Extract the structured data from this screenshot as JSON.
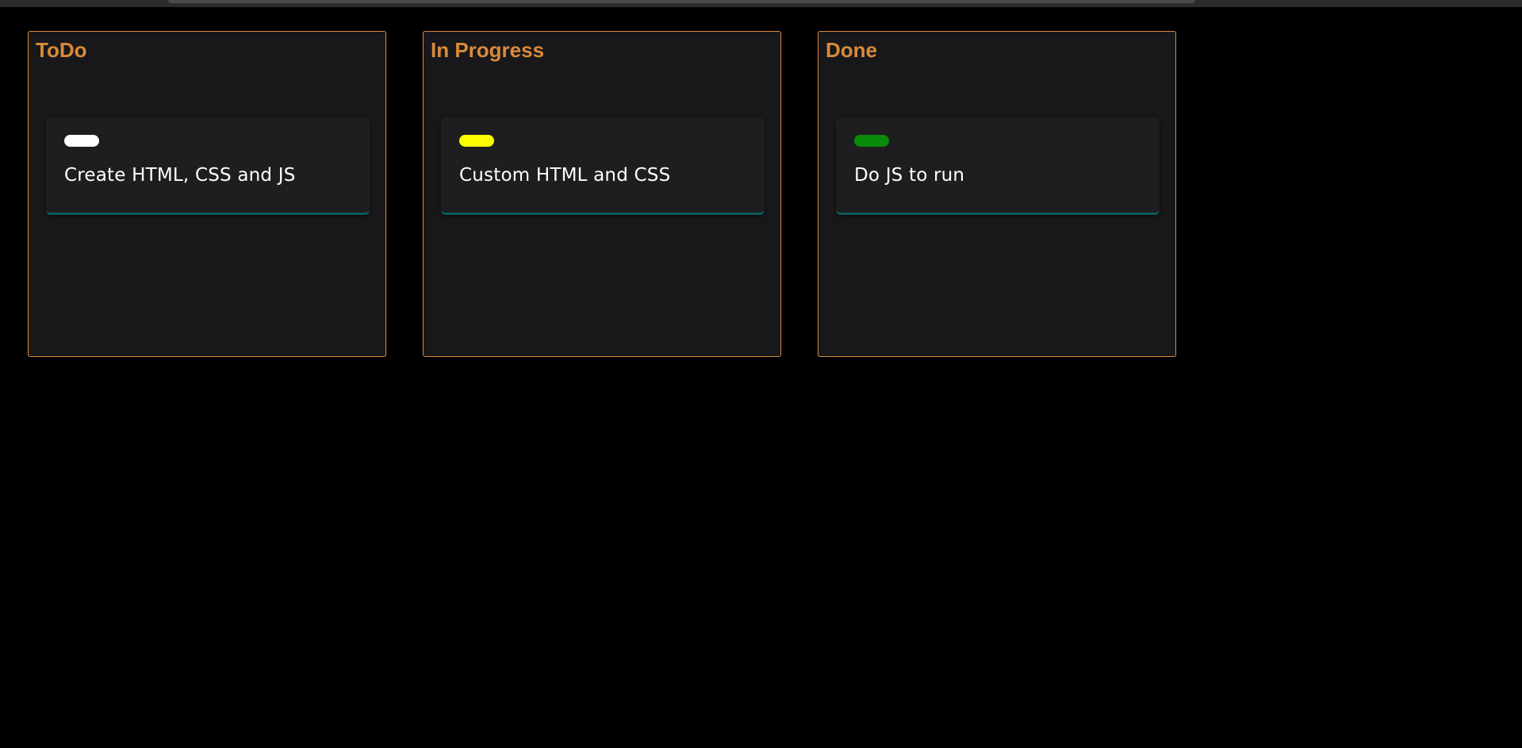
{
  "board": {
    "columns": [
      {
        "title": "ToDo",
        "cards": [
          {
            "text": "Create HTML, CSS and JS",
            "tag_color": "#ffffff"
          }
        ]
      },
      {
        "title": "In Progress",
        "cards": [
          {
            "text": "Custom HTML and CSS",
            "tag_color": "#ffff00"
          }
        ]
      },
      {
        "title": "Done",
        "cards": [
          {
            "text": "Do JS to run",
            "tag_color": "#0a8a0a"
          }
        ]
      }
    ]
  },
  "colors": {
    "accent": "#d98a3a",
    "column_bg": "#18181a",
    "card_bg": "#1e1e20",
    "card_underline": "#0d5a5c",
    "page_bg": "#000000"
  }
}
